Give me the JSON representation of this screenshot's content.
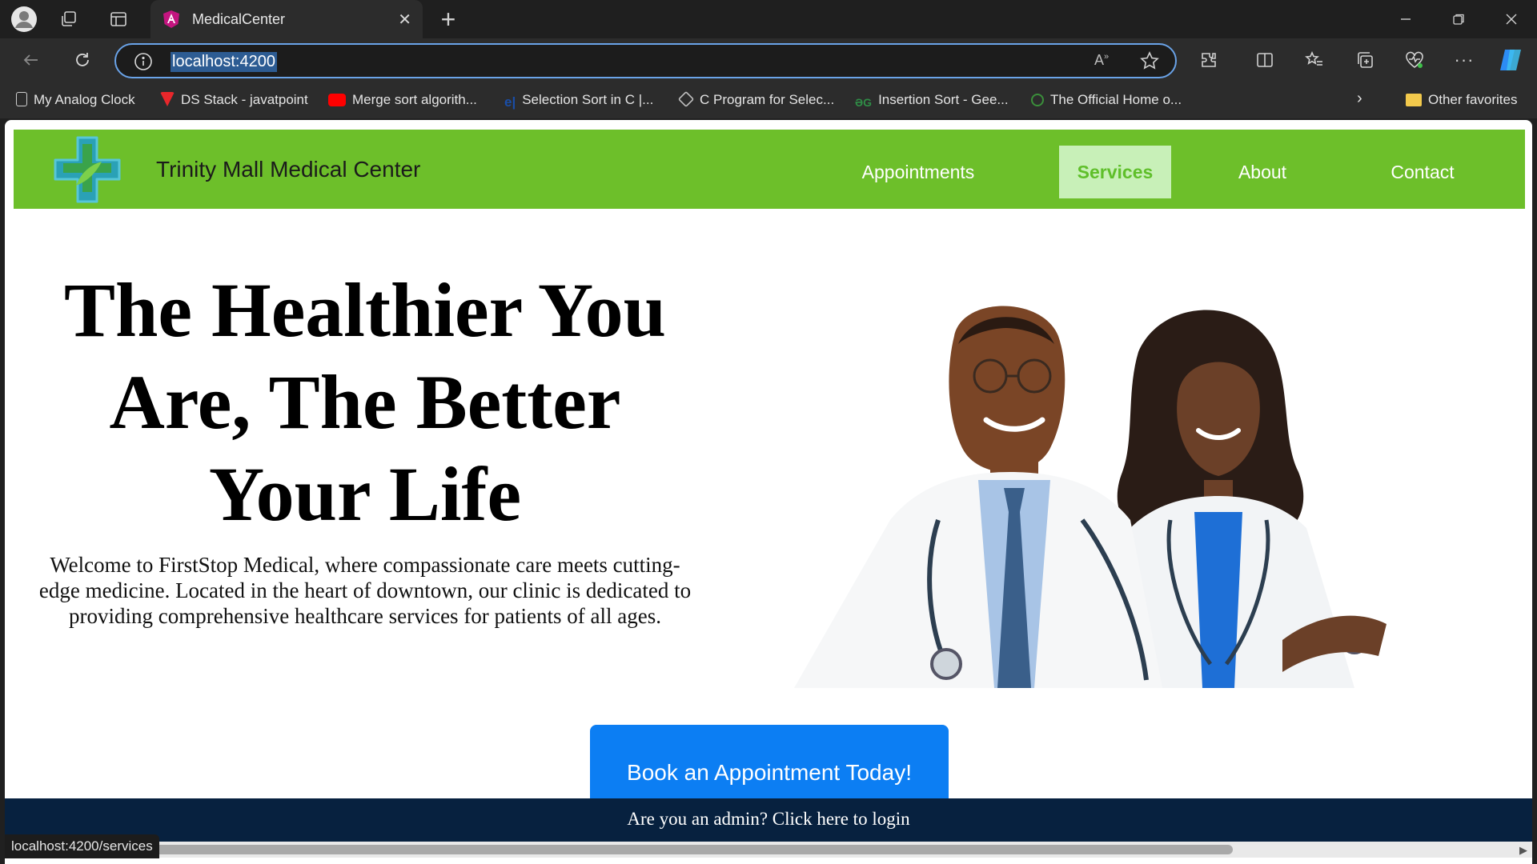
{
  "browser": {
    "tab_title": "MedicalCenter",
    "tab_close": "✕",
    "new_tab": "+",
    "url": "localhost:4200",
    "status_url": "localhost:4200/services",
    "bookmarks": [
      {
        "label": "My Analog Clock",
        "icon": "page-icon",
        "color": "#cfcfcf"
      },
      {
        "label": "DS Stack - javatpoint",
        "icon": "javatpoint-icon",
        "color": "#e8272b"
      },
      {
        "label": "Merge sort algorith...",
        "icon": "youtube-icon",
        "color": "#ff0000"
      },
      {
        "label": "Selection Sort in C |...",
        "icon": "e-icon",
        "color": "#1a4ea8"
      },
      {
        "label": "C Program for Selec...",
        "icon": "c-program-icon",
        "color": "#c0c0c0"
      },
      {
        "label": "Insertion Sort - Gee...",
        "icon": "gfg-icon",
        "color": "#2f8d46"
      },
      {
        "label": "The Official Home o...",
        "icon": "gcc-icon",
        "color": "#3b8f3b"
      }
    ],
    "other_favorites": "Other favorites"
  },
  "navbar": {
    "brand": "Trinity Mall Medical Center",
    "brand_color": "#6dbf2a",
    "links": [
      "Appointments",
      "Services",
      "About",
      "Contact"
    ],
    "active": "Services"
  },
  "hero": {
    "title": "The Healthier You Are, The Better Your Life",
    "text": "Welcome to FirstStop Medical, where compassionate care meets cutting-edge medicine. Located in the heart of downtown, our clinic is dedicated to providing comprehensive healthcare services for patients of all ages."
  },
  "cta": {
    "label": "Book an Appointment Today!",
    "color": "#0c7ef3"
  },
  "footer": {
    "admin_link": "Are you an admin? Click here to login",
    "color": "#07213f"
  }
}
